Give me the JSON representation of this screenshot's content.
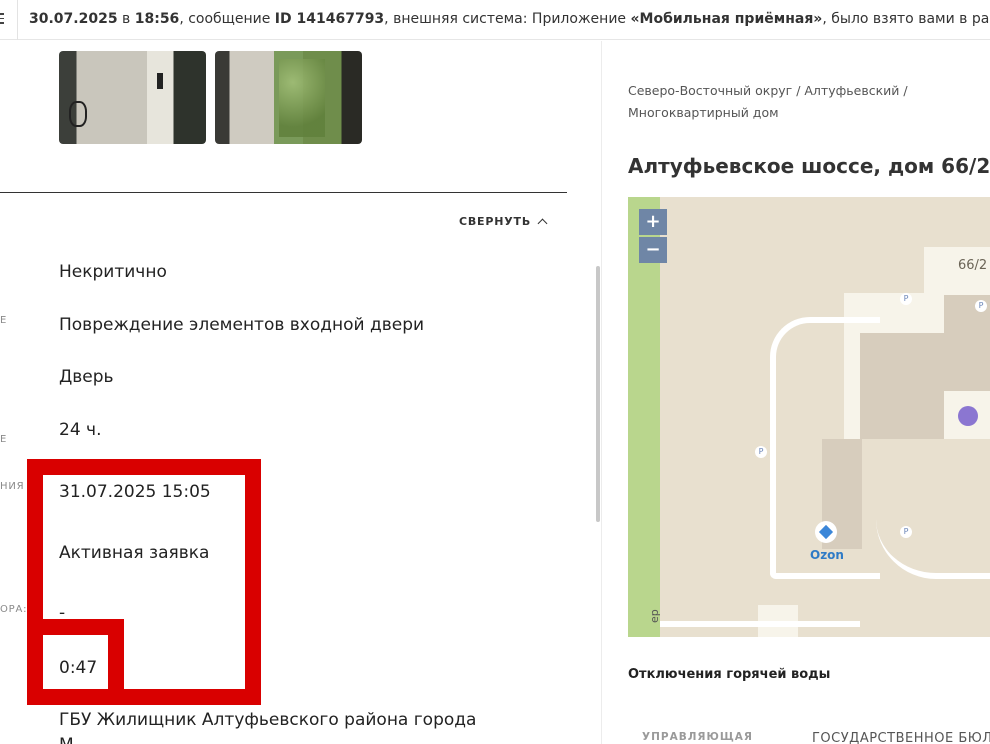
{
  "topbar": {
    "date": "30.07.2025",
    "word_in": " в ",
    "time": "18:56",
    "text1": ", сообщение ",
    "id": "ID 141467793",
    "text2": ", внешняя система: Приложение ",
    "app": "«Мобильная приёмная»",
    "text3": ", было взято вами в работу"
  },
  "details": {
    "collapse_label": "СВЕРНУТЬ",
    "criticality": "Некритично",
    "problem": "Повреждение элементов входной двери",
    "object": "Дверь",
    "deadline": "24 ч.",
    "due_date": "31.07.2025 15:05",
    "status": "Активная заявка",
    "dash": "-",
    "elapsed": "0:47",
    "organization": "ГБУ Жилищник Алтуфьевского района города",
    "organization_cont": "М",
    "cut_labels": [
      "Е",
      "Е",
      "НИЯ",
      "ОРА:"
    ]
  },
  "location": {
    "breadcrumb_line1": "Северо-Восточный округ / Алтуфьевский /",
    "breadcrumb_line2": "Многоквартирный дом",
    "address": "Алтуфьевское шоссе, дом 66/2"
  },
  "map": {
    "zoom_in": "+",
    "zoom_out": "−",
    "house_number": "66/2",
    "parking": "P",
    "poi_label": "Ozon",
    "street_fragment": "ер"
  },
  "hot_water": {
    "title": "Отключения горячей воды"
  },
  "management": {
    "label": "УПРАВЛЯЮЩАЯ",
    "value": "ГОСУДАРСТВЕННОЕ БЮЛ"
  },
  "colors": {
    "highlight": "#d90000",
    "zoom_button": "#6f86a6",
    "park": "#b9d68d",
    "ozon": "#2f7bc6"
  }
}
